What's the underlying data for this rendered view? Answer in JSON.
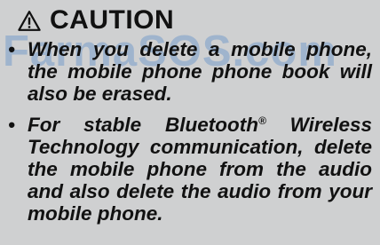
{
  "heading": {
    "icon": "warning-triangle-icon",
    "title": "CAUTION"
  },
  "watermark": {
    "text": "FarmaSOS.com",
    "color": "#5c8dc9"
  },
  "bullets": {
    "marker": "•",
    "items": [
      {
        "text": "When you delete a mobile phone, the mobile phone phone book will also be erased."
      },
      {
        "text_before": "For stable Bluetooth",
        "registered_mark": "®",
        "text_after": " Wireless Technology communication, delete the mobile phone from the audio and also delete the audio from your mobile phone."
      }
    ]
  },
  "colors": {
    "background": "#cfd0d1",
    "text": "#111111"
  }
}
